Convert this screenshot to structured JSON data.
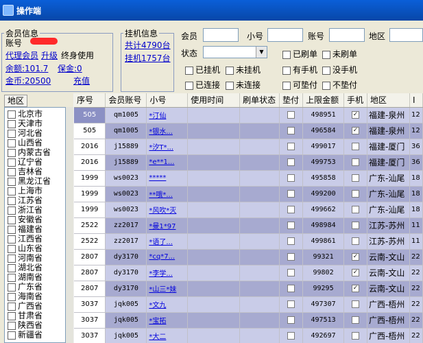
{
  "window": {
    "title": "操作端"
  },
  "member_info": {
    "legend": "会员信息",
    "account_label": "账号",
    "agent_link": "代理会员",
    "upgrade_link": "升级",
    "lifetime": "终身使用",
    "balance": "余额:101.7",
    "deposit": "保金:0",
    "coins": "金币:20500",
    "recharge": "充值"
  },
  "hang_info": {
    "legend": "挂机信息",
    "total": "共计4790台",
    "hanging": "挂机1757台"
  },
  "filters": {
    "member_label": "会员",
    "small_label": "小号",
    "account_label": "账号",
    "region_label": "地区",
    "status_label": "状态",
    "checkboxes": {
      "brushed": "已刷单",
      "unbrushed": "未刷单",
      "hung": "已挂机",
      "unhung": "未挂机",
      "has_phone": "有手机",
      "no_phone": "没手机",
      "connected": "已连接",
      "unconnected": "未连接",
      "can_advance": "可垫付",
      "no_advance": "不垫付"
    }
  },
  "region_panel": {
    "header": "地区",
    "items": [
      "北京市",
      "天津市",
      "河北省",
      "山西省",
      "内蒙古省",
      "辽宁省",
      "吉林省",
      "黑龙江省",
      "上海市",
      "江苏省",
      "浙江省",
      "安徽省",
      "福建省",
      "江西省",
      "山东省",
      "河南省",
      "湖北省",
      "湖南省",
      "广东省",
      "海南省",
      "广西省",
      "甘肃省",
      "陕西省",
      "新疆省"
    ]
  },
  "grid": {
    "columns": [
      "序号",
      "会员账号",
      "小号",
      "使用时间",
      "刷单状态",
      "垫付",
      "上限金额",
      "手机",
      "地区",
      "I"
    ],
    "rows": [
      {
        "no": "505",
        "account": "qm1005",
        "nick": "*汀仙",
        "limit": "498951",
        "phone": true,
        "area": "福建-泉州",
        "extra": "12"
      },
      {
        "no": "505",
        "account": "qm1005",
        "nick": "*银水...",
        "limit": "496584",
        "phone": true,
        "area": "福建-泉州",
        "extra": "12"
      },
      {
        "no": "2016",
        "account": "j15889",
        "nick": "*汐T*...",
        "limit": "499017",
        "phone": false,
        "area": "福建-厦门",
        "extra": "36"
      },
      {
        "no": "2016",
        "account": "j15889",
        "nick": "*e**1...",
        "limit": "499753",
        "phone": false,
        "area": "福建-厦门",
        "extra": "36"
      },
      {
        "no": "1999",
        "account": "ws0023",
        "nick": "*****",
        "limit": "495858",
        "phone": false,
        "area": "广东-汕尾",
        "extra": "18"
      },
      {
        "no": "1999",
        "account": "ws0023",
        "nick": "**哦*...",
        "limit": "499200",
        "phone": false,
        "area": "广东-汕尾",
        "extra": "18"
      },
      {
        "no": "1999",
        "account": "ws0023",
        "nick": "*风吹*灭",
        "limit": "499662",
        "phone": false,
        "area": "广东-汕尾",
        "extra": "18"
      },
      {
        "no": "2522",
        "account": "zz2017",
        "nick": "*曼1*97",
        "limit": "498984",
        "phone": false,
        "area": "江苏-苏州",
        "extra": "11"
      },
      {
        "no": "2522",
        "account": "zz2017",
        "nick": "*语了...",
        "limit": "499861",
        "phone": false,
        "area": "江苏-苏州",
        "extra": "11"
      },
      {
        "no": "2807",
        "account": "dy3170",
        "nick": "*cq*7...",
        "limit": "99321",
        "phone": true,
        "area": "云南-文山",
        "extra": "22"
      },
      {
        "no": "2807",
        "account": "dy3170",
        "nick": "*李学...",
        "limit": "99802",
        "phone": true,
        "area": "云南-文山",
        "extra": "22"
      },
      {
        "no": "2807",
        "account": "dy3170",
        "nick": "*山三*妹",
        "limit": "99295",
        "phone": true,
        "area": "云南-文山",
        "extra": "22"
      },
      {
        "no": "3037",
        "account": "jqk005",
        "nick": "*文九",
        "limit": "497307",
        "phone": false,
        "area": "广西-梧州",
        "extra": "22"
      },
      {
        "no": "3037",
        "account": "jqk005",
        "nick": "*宝拓",
        "limit": "497513",
        "phone": false,
        "area": "广西-梧州",
        "extra": "22"
      },
      {
        "no": "3037",
        "account": "jqk005",
        "nick": "*大二",
        "limit": "492697",
        "phone": false,
        "area": "广西-梧州",
        "extra": "22"
      }
    ]
  }
}
